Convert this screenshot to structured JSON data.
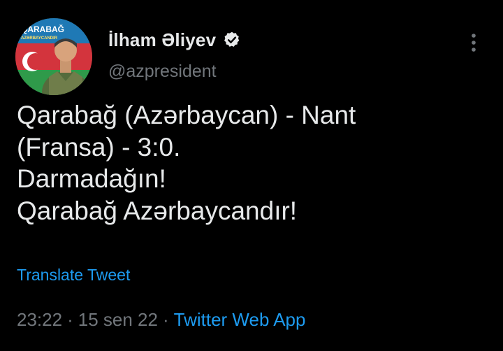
{
  "author": {
    "display_name": "İlham Əliyev",
    "handle": "@azpresident",
    "verified_icon": "verified-badge-icon",
    "avatar_text_top": "QARABAĞ",
    "avatar_text_sub": "AZƏRBAYCANDIR"
  },
  "tweet": {
    "lines": [
      "Qarabağ (Azərbaycan) - Nant",
      "(Fransa) - 3:0.",
      "Darmadağın!",
      "Qarabağ Azərbaycandır!"
    ],
    "translate_label": "Translate Tweet"
  },
  "meta": {
    "time": "23:22",
    "date": "15 sen 22",
    "separator": "·",
    "source": "Twitter Web App"
  },
  "colors": {
    "background": "#000000",
    "text": "#e7e9ea",
    "muted": "#71767b",
    "accent": "#1d9bf0"
  },
  "icons": {
    "more": "more-options-icon"
  }
}
